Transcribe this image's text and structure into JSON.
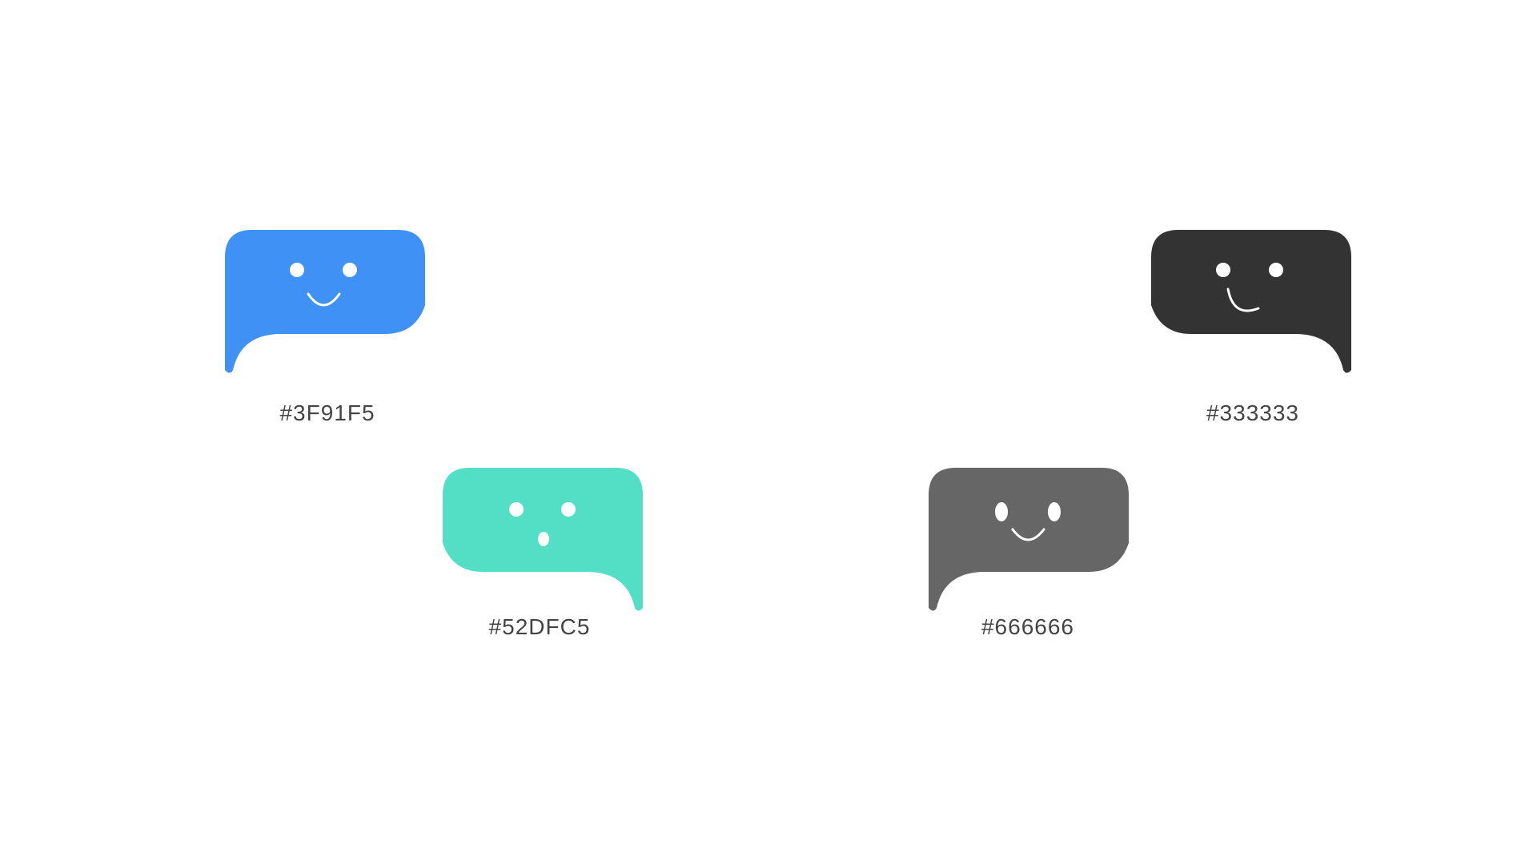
{
  "swatches": [
    {
      "color": "#3F91F5",
      "label": "#3F91F5",
      "icon": "smiling-chat-bubble-icon"
    },
    {
      "color": "#333333",
      "label": "#333333",
      "icon": "smiling-chat-bubble-icon"
    },
    {
      "color": "#52DFC5",
      "label": "#52DFC5",
      "icon": "surprised-chat-bubble-icon"
    },
    {
      "color": "#666666",
      "label": "#666666",
      "icon": "smiling-chat-bubble-icon"
    }
  ]
}
